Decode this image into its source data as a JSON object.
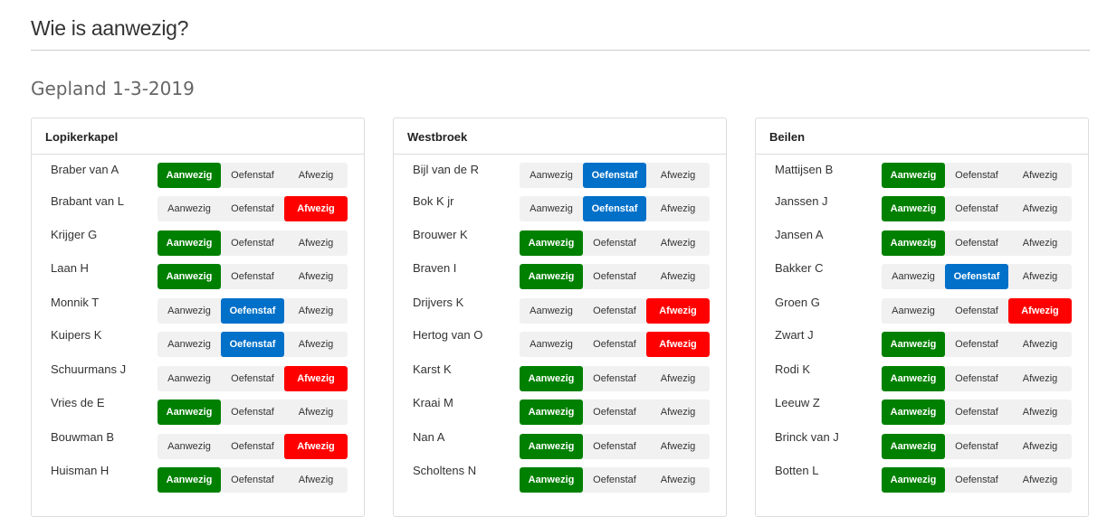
{
  "page": {
    "title": "Wie is aanwezig?",
    "subtitle": "Gepland 1-3-2019"
  },
  "labels": {
    "present": "Aanwezig",
    "staff": "Oefenstaf",
    "absent": "Afwezig"
  },
  "colors": {
    "present": "#008000",
    "staff": "#0070c9",
    "absent": "#ff0000"
  },
  "teams": [
    {
      "name": "Lopikerkapel",
      "players": [
        {
          "name": "Braber van A",
          "status": "present"
        },
        {
          "name": "Brabant van L",
          "status": "absent"
        },
        {
          "name": "Krijger G",
          "status": "present"
        },
        {
          "name": "Laan H",
          "status": "present"
        },
        {
          "name": "Monnik T",
          "status": "staff"
        },
        {
          "name": "Kuipers K",
          "status": "staff"
        },
        {
          "name": "Schuurmans J",
          "status": "absent"
        },
        {
          "name": "Vries de E",
          "status": "present"
        },
        {
          "name": "Bouwman B",
          "status": "absent"
        },
        {
          "name": "Huisman H",
          "status": "present"
        }
      ]
    },
    {
      "name": "Westbroek",
      "players": [
        {
          "name": "Bijl van de R",
          "status": "staff"
        },
        {
          "name": "Bok K jr",
          "status": "staff"
        },
        {
          "name": "Brouwer K",
          "status": "present"
        },
        {
          "name": "Braven I",
          "status": "present"
        },
        {
          "name": "Drijvers K",
          "status": "absent"
        },
        {
          "name": "Hertog van O",
          "status": "absent"
        },
        {
          "name": "Karst K",
          "status": "present"
        },
        {
          "name": "Kraai M",
          "status": "present"
        },
        {
          "name": "Nan A",
          "status": "present"
        },
        {
          "name": "Scholtens N",
          "status": "present"
        }
      ]
    },
    {
      "name": "Beilen",
      "players": [
        {
          "name": "Mattijsen B",
          "status": "present"
        },
        {
          "name": "Janssen J",
          "status": "present"
        },
        {
          "name": "Jansen A",
          "status": "present"
        },
        {
          "name": "Bakker C",
          "status": "staff"
        },
        {
          "name": "Groen G",
          "status": "absent"
        },
        {
          "name": "Zwart J",
          "status": "present"
        },
        {
          "name": "Rodi K",
          "status": "present"
        },
        {
          "name": "Leeuw Z",
          "status": "present"
        },
        {
          "name": "Brinck van J",
          "status": "present"
        },
        {
          "name": "Botten L",
          "status": "present"
        }
      ]
    }
  ]
}
